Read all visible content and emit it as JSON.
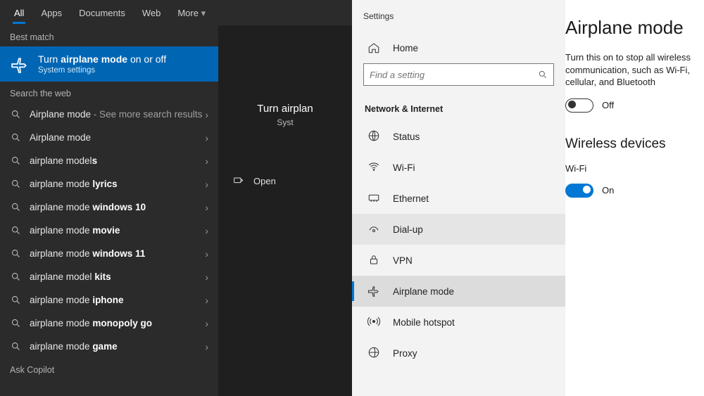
{
  "search": {
    "tabs": [
      "All",
      "Apps",
      "Documents",
      "Web",
      "More"
    ],
    "active_tab": 0,
    "best_match_label": "Best match",
    "best_match": {
      "title_pre": "Turn ",
      "title_bold": "airplane mode",
      "title_post": " on or off",
      "subtitle": "System settings"
    },
    "search_web_label": "Search the web",
    "results": [
      {
        "pre": "Airplane mode",
        "bold": "",
        "post": " - See more search results"
      },
      {
        "pre": "Airplane mode",
        "bold": "",
        "post": ""
      },
      {
        "pre": "airplane model",
        "bold": "s",
        "post": ""
      },
      {
        "pre": "airplane mode ",
        "bold": "lyrics",
        "post": ""
      },
      {
        "pre": "airplane mode ",
        "bold": "windows 10",
        "post": ""
      },
      {
        "pre": "airplane mode ",
        "bold": "movie",
        "post": ""
      },
      {
        "pre": "airplane mode ",
        "bold": "windows 11",
        "post": ""
      },
      {
        "pre": "airplane model ",
        "bold": "kits",
        "post": ""
      },
      {
        "pre": "airplane mode ",
        "bold": "iphone",
        "post": ""
      },
      {
        "pre": "airplane mode ",
        "bold": "monopoly go",
        "post": ""
      },
      {
        "pre": "airplane mode ",
        "bold": "game",
        "post": ""
      }
    ],
    "ask_copilot_label": "Ask Copilot",
    "preview": {
      "title": "Turn airplan",
      "subtitle": "Syst",
      "open_label": "Open"
    }
  },
  "settings": {
    "header": "Settings",
    "home_label": "Home",
    "find_placeholder": "Find a setting",
    "category": "Network & Internet",
    "nav": [
      {
        "label": "Status",
        "icon": "globe"
      },
      {
        "label": "Wi-Fi",
        "icon": "wifi"
      },
      {
        "label": "Ethernet",
        "icon": "ethernet"
      },
      {
        "label": "Dial-up",
        "icon": "dialup"
      },
      {
        "label": "VPN",
        "icon": "vpn"
      },
      {
        "label": "Airplane mode",
        "icon": "airplane"
      },
      {
        "label": "Mobile hotspot",
        "icon": "hotspot"
      },
      {
        "label": "Proxy",
        "icon": "proxy"
      }
    ],
    "selected_nav": "Airplane mode",
    "hover_nav": "Dial-up",
    "page": {
      "title": "Airplane mode",
      "desc": "Turn this on to stop all wireless communication, such as Wi-Fi, cellular, and Bluetooth",
      "airplane_toggle": {
        "on": false,
        "label": "Off"
      },
      "wireless_heading": "Wireless devices",
      "wifi_label": "Wi-Fi",
      "wifi_toggle": {
        "on": true,
        "label": "On"
      }
    }
  }
}
